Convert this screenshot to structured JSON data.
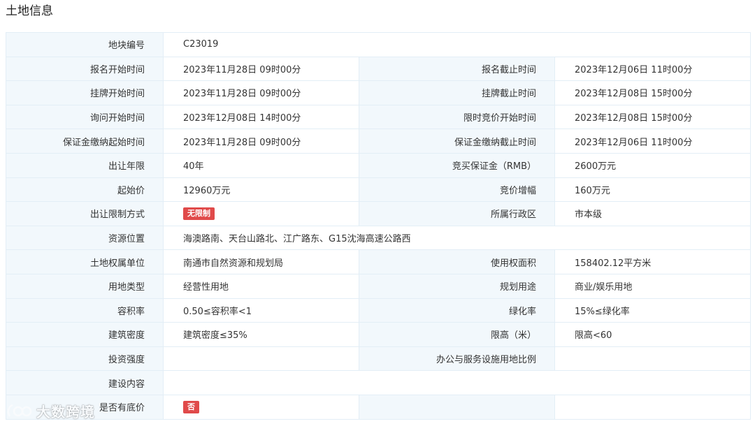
{
  "section_title": "土地信息",
  "rows": [
    {
      "full": true,
      "label": "地块编号",
      "value": "C23019"
    },
    {
      "label_a": "报名开始时间",
      "value_a": "2023年11月28日 09时00分",
      "label_b": "报名截止时间",
      "value_b": "2023年12月06日 11时00分"
    },
    {
      "label_a": "挂牌开始时间",
      "value_a": "2023年11月28日 09时00分",
      "label_b": "挂牌截止时间",
      "value_b": "2023年12月08日 15时00分"
    },
    {
      "label_a": "询问开始时间",
      "value_a": "2023年12月08日 14时00分",
      "label_b": "限时竞价开始时间",
      "value_b": "2023年12月08日 15时00分"
    },
    {
      "label_a": "保证金缴纳起始时间",
      "value_a": "2023年11月28日 09时00分",
      "label_b": "保证金缴纳截止时间",
      "value_b": "2023年12月06日 11时00分"
    },
    {
      "label_a": "出让年限",
      "value_a": "40年",
      "label_b": "竞买保证金（RMB）",
      "value_b": "2600万元"
    },
    {
      "label_a": "起始价",
      "value_a": "12960万元",
      "label_b": "竞价增幅",
      "value_b": "160万元"
    },
    {
      "label_a": "出让限制方式",
      "badge_a": "无限制",
      "label_b": "所属行政区",
      "value_b": "市本级"
    },
    {
      "full": true,
      "label": "资源位置",
      "value": "海澳路南、天台山路北、江广路东、G15沈海高速公路西"
    },
    {
      "label_a": "土地权属单位",
      "value_a": "南通市自然资源和规划局",
      "label_b": "使用权面积",
      "value_b": "158402.12平方米"
    },
    {
      "label_a": "用地类型",
      "value_a": "经营性用地",
      "label_b": "规划用途",
      "value_b": "商业/娱乐用地"
    },
    {
      "label_a": "容积率",
      "value_a": "0.50≤容积率<1",
      "label_b": "绿化率",
      "value_b": "15%≤绿化率"
    },
    {
      "label_a": "建筑密度",
      "value_a": "建筑密度≤35%",
      "label_b": "限高（米）",
      "value_b": "限高<60"
    },
    {
      "label_a": "投资强度",
      "value_a": "",
      "label_b": "办公与服务设施用地比例",
      "value_b": ""
    },
    {
      "full": true,
      "label": "建设内容",
      "value": ""
    },
    {
      "label_a": "是否有底价",
      "badge_a": "否",
      "label_b": "",
      "value_b": ""
    }
  ],
  "watermark": {
    "text": "大数跨境"
  },
  "colors": {
    "label_bg": "#f2f8fc",
    "border": "#e3eef6",
    "badge": "#e04a4a"
  }
}
